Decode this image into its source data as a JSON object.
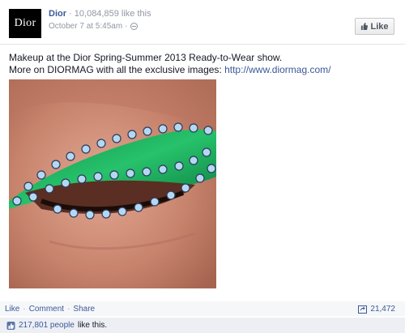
{
  "post": {
    "avatar_text": "Dior",
    "page_name": "Dior",
    "separator": " · ",
    "like_count": "10,084,859 like this",
    "timestamp": "October 7 at 5:45am",
    "sub_separator": " · ",
    "like_button_label": "Like",
    "text_line1": "Makeup at the Dior Spring-Summer 2013 Ready-to-Wear show.",
    "text_line2_prefix": "More on DIORMAG with all the exclusive images: ",
    "text_link": "http://www.diormag.com/"
  },
  "actions": {
    "like": "Like",
    "comment": "Comment",
    "share": "Share",
    "dot": "·",
    "share_count": "21,472"
  },
  "likers": {
    "count": "217,801 people",
    "suffix": "like this."
  },
  "colors": {
    "link": "#3b5998",
    "meta": "#9197a3",
    "avatar_bg": "#000000",
    "eyeshadow": "#1ca65b"
  }
}
